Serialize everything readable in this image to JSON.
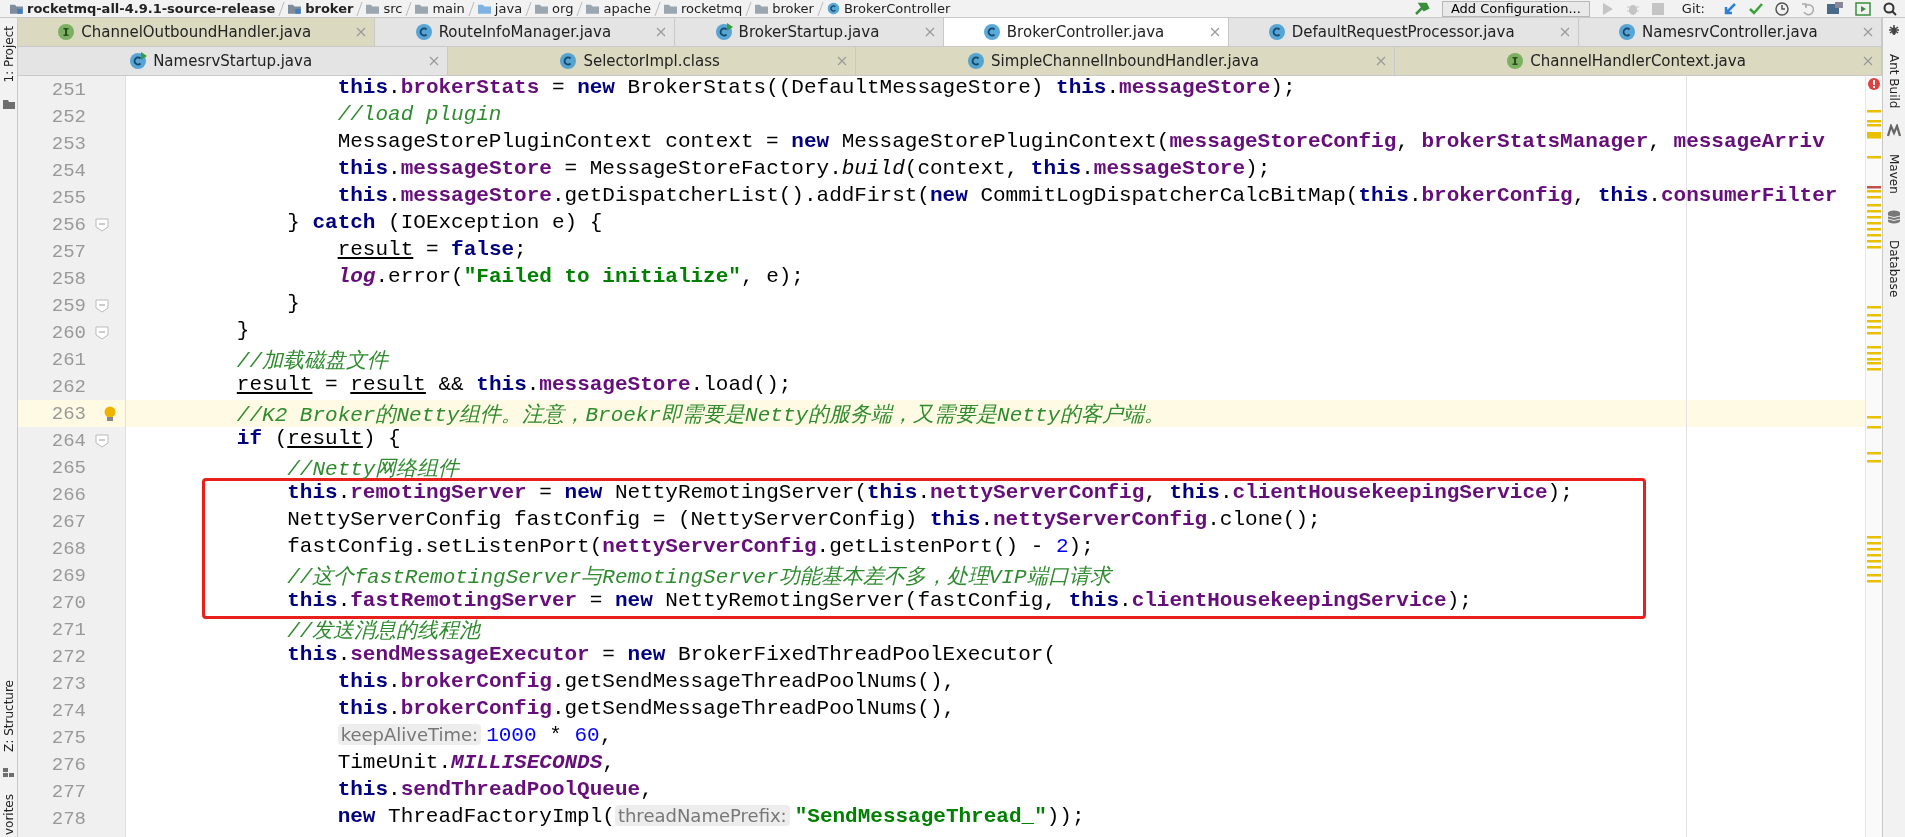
{
  "breadcrumbs": [
    {
      "kind": "module",
      "label": "rocketmq-all-4.9.1-source-release"
    },
    {
      "kind": "module",
      "label": "broker"
    },
    {
      "kind": "folder",
      "label": "src"
    },
    {
      "kind": "folder",
      "label": "main"
    },
    {
      "kind": "source",
      "label": "java"
    },
    {
      "kind": "folder",
      "label": "org"
    },
    {
      "kind": "folder",
      "label": "apache"
    },
    {
      "kind": "folder",
      "label": "rocketmq"
    },
    {
      "kind": "folder",
      "label": "broker"
    },
    {
      "kind": "class",
      "label": "BrokerController"
    }
  ],
  "toolbar": {
    "run_config": "Add Configuration...",
    "vcs_label": "Git:"
  },
  "left_tool_windows_top": [
    {
      "label": "1: Project"
    }
  ],
  "left_tool_windows_bottom": [
    {
      "label": "Z: Structure"
    },
    {
      "label": "vorites"
    }
  ],
  "right_tool_windows": [
    {
      "label": "Ant Build",
      "kind": "ant"
    },
    {
      "label": "Maven",
      "kind": "maven"
    },
    {
      "label": "Database",
      "kind": "database"
    }
  ],
  "tab_rows": [
    [
      {
        "label": "ChannelOutboundHandler.java",
        "kind": "interface",
        "library": true,
        "selected": false
      },
      {
        "label": "RouteInfoManager.java",
        "kind": "class",
        "library": false,
        "selected": false
      },
      {
        "label": "BrokerStartup.java",
        "kind": "main-class",
        "library": false,
        "selected": false
      },
      {
        "label": "BrokerController.java",
        "kind": "class",
        "library": false,
        "selected": true
      },
      {
        "label": "DefaultRequestProcessor.java",
        "kind": "class",
        "library": false,
        "selected": false
      },
      {
        "label": "NamesrvController.java",
        "kind": "class",
        "library": false,
        "selected": false
      }
    ],
    [
      {
        "label": "NamesrvStartup.java",
        "kind": "main-class",
        "library": false,
        "selected": false
      },
      {
        "label": "SelectorImpl.class",
        "kind": "class",
        "library": true,
        "selected": false
      },
      {
        "label": "SimpleChannelInboundHandler.java",
        "kind": "class",
        "library": true,
        "selected": false
      },
      {
        "label": "ChannelHandlerContext.java",
        "kind": "interface",
        "library": true,
        "selected": false
      }
    ]
  ],
  "editor": {
    "blocks": [
      {
        "boxed": false,
        "lines": [
          {
            "number": "251",
            "fold": false,
            "current": false,
            "tokens": [
              {
                "kind": "keyword",
                "text": "                this"
              },
              {
                "kind": "plain",
                "text": "."
              },
              {
                "kind": "field",
                "text": "brokerStats"
              },
              {
                "kind": "plain",
                "text": " = "
              },
              {
                "kind": "keyword",
                "text": "new"
              },
              {
                "kind": "plain",
                "text": " BrokerStats((DefaultMessageStore) "
              },
              {
                "kind": "keyword",
                "text": "this"
              },
              {
                "kind": "plain",
                "text": "."
              },
              {
                "kind": "field",
                "text": "messageStore"
              },
              {
                "kind": "plain",
                "text": ");"
              }
            ]
          },
          {
            "number": "252",
            "fold": false,
            "current": false,
            "tokens": [
              {
                "kind": "comment",
                "text": "                //load plugin"
              }
            ]
          },
          {
            "number": "253",
            "fold": false,
            "current": false,
            "tokens": [
              {
                "kind": "plain",
                "text": "                MessageStorePluginContext context = "
              },
              {
                "kind": "keyword",
                "text": "new"
              },
              {
                "kind": "plain",
                "text": " MessageStorePluginContext("
              },
              {
                "kind": "field",
                "text": "messageStoreConfig"
              },
              {
                "kind": "plain",
                "text": ", "
              },
              {
                "kind": "field",
                "text": "brokerStatsManager"
              },
              {
                "kind": "plain",
                "text": ", "
              },
              {
                "kind": "field",
                "text": "messageArriv"
              }
            ]
          },
          {
            "number": "254",
            "fold": false,
            "current": false,
            "tokens": [
              {
                "kind": "keyword",
                "text": "                this"
              },
              {
                "kind": "plain",
                "text": "."
              },
              {
                "kind": "field",
                "text": "messageStore"
              },
              {
                "kind": "plain",
                "text": " = MessageStoreFactory."
              },
              {
                "kind": "static-method",
                "text": "build"
              },
              {
                "kind": "plain",
                "text": "(context, "
              },
              {
                "kind": "keyword",
                "text": "this"
              },
              {
                "kind": "plain",
                "text": "."
              },
              {
                "kind": "field",
                "text": "messageStore"
              },
              {
                "kind": "plain",
                "text": ");"
              }
            ]
          },
          {
            "number": "255",
            "fold": false,
            "current": false,
            "tokens": [
              {
                "kind": "keyword",
                "text": "                this"
              },
              {
                "kind": "plain",
                "text": "."
              },
              {
                "kind": "field",
                "text": "messageStore"
              },
              {
                "kind": "plain",
                "text": ".getDispatcherList().addFirst("
              },
              {
                "kind": "keyword",
                "text": "new"
              },
              {
                "kind": "plain",
                "text": " CommitLogDispatcherCalcBitMap("
              },
              {
                "kind": "keyword",
                "text": "this"
              },
              {
                "kind": "plain",
                "text": "."
              },
              {
                "kind": "field",
                "text": "brokerConfig"
              },
              {
                "kind": "plain",
                "text": ", "
              },
              {
                "kind": "keyword",
                "text": "this"
              },
              {
                "kind": "plain",
                "text": "."
              },
              {
                "kind": "field",
                "text": "consumerFilter"
              }
            ]
          },
          {
            "number": "256",
            "fold": true,
            "current": false,
            "tokens": [
              {
                "kind": "plain",
                "text": "            } "
              },
              {
                "kind": "keyword",
                "text": "catch"
              },
              {
                "kind": "plain",
                "text": " (IOException e) {"
              }
            ]
          },
          {
            "number": "257",
            "fold": false,
            "current": false,
            "tokens": [
              {
                "kind": "local",
                "text": "                result"
              },
              {
                "kind": "plain",
                "text": " = "
              },
              {
                "kind": "keyword",
                "text": "false"
              },
              {
                "kind": "plain",
                "text": ";"
              }
            ]
          },
          {
            "number": "258",
            "fold": false,
            "current": false,
            "tokens": [
              {
                "kind": "static-field",
                "text": "                log"
              },
              {
                "kind": "plain",
                "text": ".error("
              },
              {
                "kind": "string",
                "text": "\"Failed to initialize\""
              },
              {
                "kind": "plain",
                "text": ", e);"
              }
            ]
          },
          {
            "number": "259",
            "fold": true,
            "current": false,
            "tokens": [
              {
                "kind": "plain",
                "text": "            }"
              }
            ]
          },
          {
            "number": "260",
            "fold": true,
            "current": false,
            "tokens": [
              {
                "kind": "plain",
                "text": "        }"
              }
            ]
          },
          {
            "number": "261",
            "fold": false,
            "current": false,
            "tokens": [
              {
                "kind": "comment",
                "text": "        //加载磁盘文件"
              }
            ]
          },
          {
            "number": "262",
            "fold": false,
            "current": false,
            "tokens": [
              {
                "kind": "local",
                "text": "        result"
              },
              {
                "kind": "plain",
                "text": " = "
              },
              {
                "kind": "local",
                "text": "result"
              },
              {
                "kind": "plain",
                "text": " && "
              },
              {
                "kind": "keyword",
                "text": "this"
              },
              {
                "kind": "plain",
                "text": "."
              },
              {
                "kind": "field",
                "text": "messageStore"
              },
              {
                "kind": "plain",
                "text": ".load();"
              }
            ]
          },
          {
            "number": "263",
            "fold": false,
            "current": true,
            "tokens": [
              {
                "kind": "comment",
                "text": "        //K2 Broker的Netty组件。注意，Broekr即需要是Netty的服务端，又需要是Netty的客户端。"
              }
            ]
          },
          {
            "number": "264",
            "fold": true,
            "current": false,
            "tokens": [
              {
                "kind": "keyword",
                "text": "        if"
              },
              {
                "kind": "plain",
                "text": " ("
              },
              {
                "kind": "local",
                "text": "result"
              },
              {
                "kind": "plain",
                "text": ") {"
              }
            ]
          },
          {
            "number": "265",
            "fold": false,
            "current": false,
            "tokens": [
              {
                "kind": "comment",
                "text": "            //Netty网络组件"
              }
            ]
          }
        ]
      },
      {
        "boxed": true,
        "lines": [
          {
            "number": "266",
            "fold": false,
            "current": false,
            "tokens": [
              {
                "kind": "keyword",
                "text": "            this"
              },
              {
                "kind": "plain",
                "text": "."
              },
              {
                "kind": "field",
                "text": "remotingServer"
              },
              {
                "kind": "plain",
                "text": " = "
              },
              {
                "kind": "keyword",
                "text": "new"
              },
              {
                "kind": "plain",
                "text": " NettyRemotingServer("
              },
              {
                "kind": "keyword",
                "text": "this"
              },
              {
                "kind": "plain",
                "text": "."
              },
              {
                "kind": "field",
                "text": "nettyServerConfig"
              },
              {
                "kind": "plain",
                "text": ", "
              },
              {
                "kind": "keyword",
                "text": "this"
              },
              {
                "kind": "plain",
                "text": "."
              },
              {
                "kind": "field",
                "text": "clientHousekeepingService"
              },
              {
                "kind": "plain",
                "text": ");"
              }
            ]
          },
          {
            "number": "267",
            "fold": false,
            "current": false,
            "tokens": [
              {
                "kind": "plain",
                "text": "            NettyServerConfig fastConfig = (NettyServerConfig) "
              },
              {
                "kind": "keyword",
                "text": "this"
              },
              {
                "kind": "plain",
                "text": "."
              },
              {
                "kind": "field",
                "text": "nettyServerConfig"
              },
              {
                "kind": "plain",
                "text": ".clone();"
              }
            ]
          },
          {
            "number": "268",
            "fold": false,
            "current": false,
            "tokens": [
              {
                "kind": "plain",
                "text": "            fastConfig.setListenPort("
              },
              {
                "kind": "field",
                "text": "nettyServerConfig"
              },
              {
                "kind": "plain",
                "text": ".getListenPort() - "
              },
              {
                "kind": "number",
                "text": "2"
              },
              {
                "kind": "plain",
                "text": ");"
              }
            ]
          },
          {
            "number": "269",
            "fold": false,
            "current": false,
            "tokens": [
              {
                "kind": "comment",
                "text": "            //这个fastRemotingServer与RemotingServer功能基本差不多，处理VIP端口请求"
              }
            ]
          },
          {
            "number": "270",
            "fold": false,
            "current": false,
            "tokens": [
              {
                "kind": "keyword",
                "text": "            this"
              },
              {
                "kind": "plain",
                "text": "."
              },
              {
                "kind": "field",
                "text": "fastRemotingServer"
              },
              {
                "kind": "plain",
                "text": " = "
              },
              {
                "kind": "keyword",
                "text": "new"
              },
              {
                "kind": "plain",
                "text": " NettyRemotingServer(fastConfig, "
              },
              {
                "kind": "keyword",
                "text": "this"
              },
              {
                "kind": "plain",
                "text": "."
              },
              {
                "kind": "field",
                "text": "clientHousekeepingService"
              },
              {
                "kind": "plain",
                "text": ");"
              }
            ]
          }
        ]
      },
      {
        "boxed": false,
        "lines": [
          {
            "number": "271",
            "fold": false,
            "current": false,
            "tokens": [
              {
                "kind": "comment",
                "text": "            //发送消息的线程池"
              }
            ]
          },
          {
            "number": "272",
            "fold": false,
            "current": false,
            "tokens": [
              {
                "kind": "keyword",
                "text": "            this"
              },
              {
                "kind": "plain",
                "text": "."
              },
              {
                "kind": "field",
                "text": "sendMessageExecutor"
              },
              {
                "kind": "plain",
                "text": " = "
              },
              {
                "kind": "keyword",
                "text": "new"
              },
              {
                "kind": "plain",
                "text": " BrokerFixedThreadPoolExecutor("
              }
            ]
          },
          {
            "number": "273",
            "fold": false,
            "current": false,
            "tokens": [
              {
                "kind": "keyword",
                "text": "                this"
              },
              {
                "kind": "plain",
                "text": "."
              },
              {
                "kind": "field",
                "text": "brokerConfig"
              },
              {
                "kind": "plain",
                "text": ".getSendMessageThreadPoolNums(),"
              }
            ]
          },
          {
            "number": "274",
            "fold": false,
            "current": false,
            "tokens": [
              {
                "kind": "keyword",
                "text": "                this"
              },
              {
                "kind": "plain",
                "text": "."
              },
              {
                "kind": "field",
                "text": "brokerConfig"
              },
              {
                "kind": "plain",
                "text": ".getSendMessageThreadPoolNums(),"
              }
            ]
          },
          {
            "number": "275",
            "fold": false,
            "current": false,
            "tokens": [
              {
                "kind": "hint",
                "text": "                keepAliveTime:"
              },
              {
                "kind": "number",
                "text": "1000"
              },
              {
                "kind": "plain",
                "text": " * "
              },
              {
                "kind": "number",
                "text": "60"
              },
              {
                "kind": "plain",
                "text": ","
              }
            ]
          },
          {
            "number": "276",
            "fold": false,
            "current": false,
            "tokens": [
              {
                "kind": "plain",
                "text": "                TimeUnit."
              },
              {
                "kind": "static-field",
                "text": "MILLISECONDS"
              },
              {
                "kind": "plain",
                "text": ","
              }
            ]
          },
          {
            "number": "277",
            "fold": false,
            "current": false,
            "tokens": [
              {
                "kind": "keyword",
                "text": "                this"
              },
              {
                "kind": "plain",
                "text": "."
              },
              {
                "kind": "field",
                "text": "sendThreadPoolQueue"
              },
              {
                "kind": "plain",
                "text": ","
              }
            ]
          },
          {
            "number": "278",
            "fold": false,
            "current": false,
            "tokens": [
              {
                "kind": "keyword",
                "text": "                new"
              },
              {
                "kind": "plain",
                "text": " ThreadFactoryImpl("
              },
              {
                "kind": "hint",
                "text": "threadNamePrefix:"
              },
              {
                "kind": "string",
                "text": "\"SendMessageThread_\""
              },
              {
                "kind": "plain",
                "text": "));"
              }
            ]
          }
        ]
      }
    ]
  }
}
